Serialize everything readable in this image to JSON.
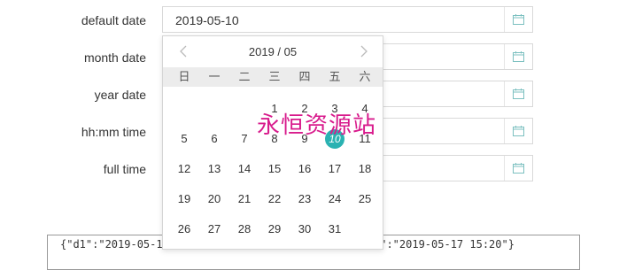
{
  "form": {
    "rows": [
      {
        "label": "default date",
        "value": "2019-05-10"
      },
      {
        "label": "month date",
        "value": ""
      },
      {
        "label": "year date",
        "value": ""
      },
      {
        "label": "hh:mm time",
        "value": ""
      },
      {
        "label": "full time",
        "value": ""
      }
    ]
  },
  "calendar": {
    "title": "2019 / 05",
    "weekdays": [
      "日",
      "一",
      "二",
      "三",
      "四",
      "五",
      "六"
    ],
    "weeks": [
      [
        "",
        "",
        "",
        "1",
        "2",
        "3",
        "4"
      ],
      [
        "5",
        "6",
        "7",
        "8",
        "9",
        "10",
        "11"
      ],
      [
        "12",
        "13",
        "14",
        "15",
        "16",
        "17",
        "18"
      ],
      [
        "19",
        "20",
        "21",
        "22",
        "23",
        "24",
        "25"
      ],
      [
        "26",
        "27",
        "28",
        "29",
        "30",
        "31",
        ""
      ]
    ],
    "selected_day": "10",
    "accent_color": "#2ab2b2"
  },
  "output": {
    "json_text": "{\"d1\":\"2019-05-10                          35\",\"d5\":\"2019-05-17 15:20\"}"
  },
  "watermark": {
    "text": "永恒资源站",
    "color": "#d81b8c"
  },
  "icons": {
    "calendar": "calendar-icon",
    "prev": "chevron-left-icon",
    "next": "chevron-right-icon"
  }
}
